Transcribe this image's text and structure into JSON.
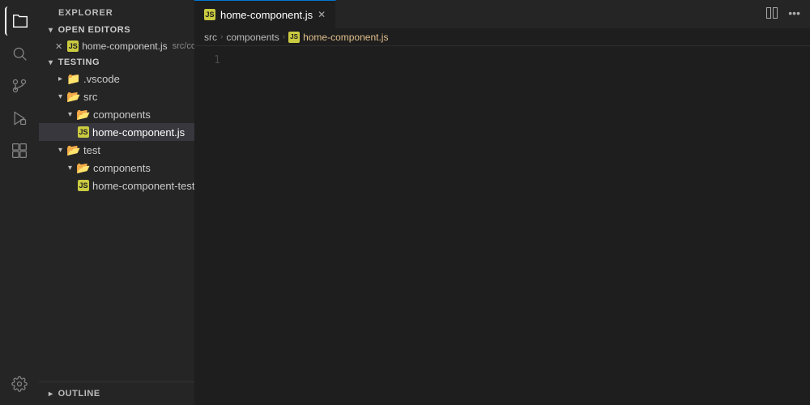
{
  "activityBar": {
    "icons": [
      {
        "name": "explorer-icon",
        "symbol": "⎘",
        "active": true
      },
      {
        "name": "search-icon",
        "symbol": "🔍",
        "active": false
      },
      {
        "name": "source-control-icon",
        "symbol": "⑂",
        "active": false
      },
      {
        "name": "debug-icon",
        "symbol": "▷",
        "active": false
      },
      {
        "name": "extensions-icon",
        "symbol": "⊞",
        "active": false
      }
    ],
    "bottom": [
      {
        "name": "settings-icon",
        "symbol": "⚙"
      }
    ]
  },
  "sidebar": {
    "title": "EXPLORER",
    "sections": {
      "openEditors": {
        "label": "OPEN EDITORS",
        "items": [
          {
            "closeLabel": "✕",
            "icon": "JS",
            "name": "home-component.js",
            "path": "src/com..."
          }
        ]
      },
      "testing": {
        "label": "TESTING",
        "tree": [
          {
            "indent": 1,
            "type": "folder-special",
            "label": ".vscode"
          },
          {
            "indent": 1,
            "type": "folder-src",
            "label": "src"
          },
          {
            "indent": 2,
            "type": "folder-yellow",
            "label": "components"
          },
          {
            "indent": 3,
            "type": "js",
            "label": "home-component.js",
            "active": true
          },
          {
            "indent": 1,
            "type": "folder-src",
            "label": "test"
          },
          {
            "indent": 2,
            "type": "folder-yellow",
            "label": "components"
          },
          {
            "indent": 3,
            "type": "js",
            "label": "home-component-test.js"
          }
        ]
      }
    },
    "outline": {
      "label": "OUTLINE"
    }
  },
  "editor": {
    "tab": {
      "filename": "home-component.js",
      "closeSymbol": "✕"
    },
    "breadcrumb": {
      "parts": [
        "src",
        "components",
        "home-component.js"
      ]
    },
    "lines": [
      {
        "number": 1,
        "code": ""
      }
    ]
  }
}
